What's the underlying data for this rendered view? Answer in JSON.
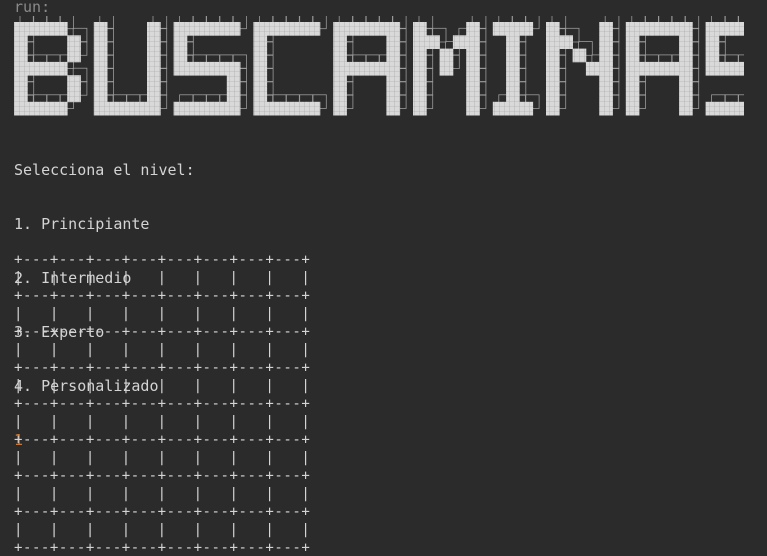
{
  "console": {
    "run_label": "run:",
    "banner_title": "BUSCAMINAS",
    "prompt": "Selecciona el nivel:",
    "options": [
      "1. Principiante",
      "2. Intermedio",
      "3. Experto",
      "4. Personalizado"
    ],
    "user_input": "1"
  },
  "board": {
    "rows": 8,
    "cols": 8,
    "border_line": "+---+---+---+---+---+---+---+---+",
    "cell_line": "|   |   |   |   |   |   |   |   |"
  },
  "colors": {
    "background": "#2b2b2b",
    "text": "#d4d4d4",
    "run_label": "#8a8a8a",
    "input": "#cc7832",
    "banner_fill": "#d9d9d9"
  }
}
